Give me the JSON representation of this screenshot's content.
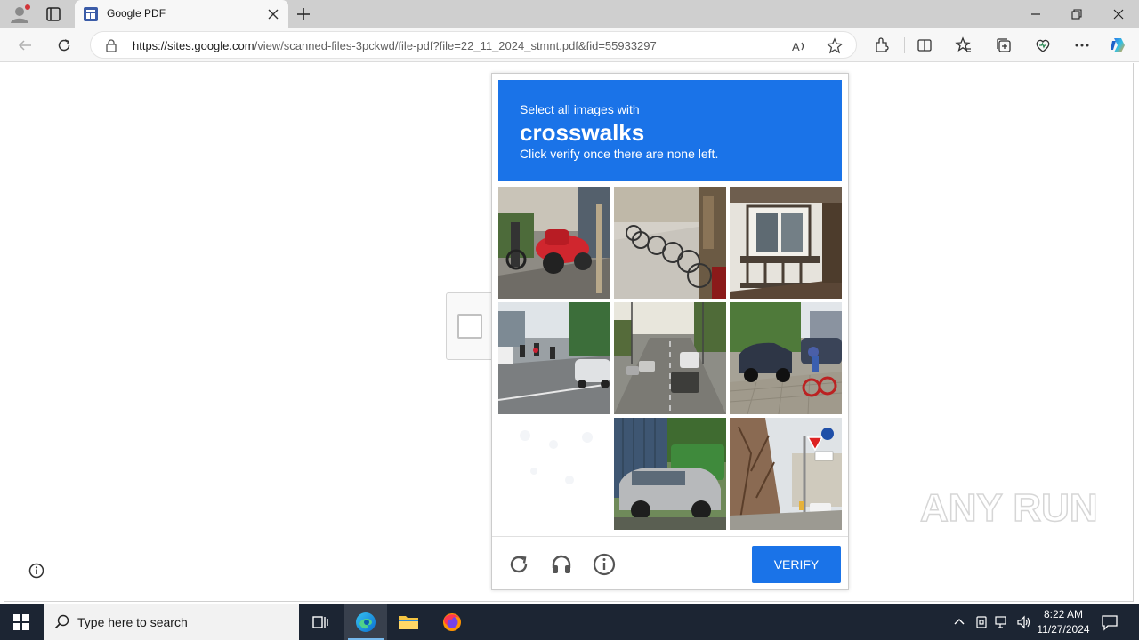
{
  "browser": {
    "tab": {
      "title": "Google PDF"
    },
    "address": {
      "url_host": "https://sites.google.com",
      "url_path": "/view/scanned-files-3pckwd/file-pdf?file=22_11_2024_stmnt.pdf&fid=55933297"
    }
  },
  "challenge": {
    "line1": "Select all images with",
    "keyword": "crosswalks",
    "line3": "Click verify once there are none left.",
    "tiles": [
      "red scooter parked on sidewalk",
      "row of bicycles on street",
      "building balcony",
      "busy street with motorbikes",
      "multi-lane road with traffic",
      "parked cars and cyclist",
      "blank (loading)",
      "silver minivan and truck",
      "street corner with sign and tree"
    ],
    "verify_label": "VERIFY",
    "footer_icons": [
      "reload-icon",
      "audio-icon",
      "info-icon"
    ]
  },
  "watermark": {
    "text": "ANY RUN"
  },
  "taskbar": {
    "search_placeholder": "Type here to search",
    "time": "8:22 AM",
    "date": "11/27/2024"
  },
  "colors": {
    "accent": "#1a73e8",
    "taskbar": "#1c2533",
    "tabstrip": "#cfcfcf"
  }
}
